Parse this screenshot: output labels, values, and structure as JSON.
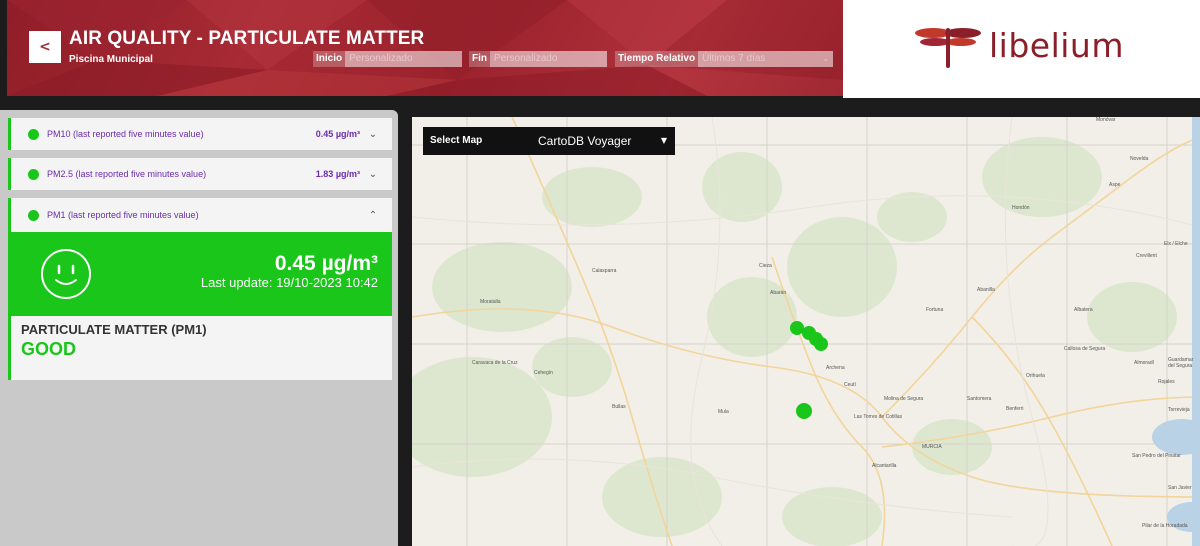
{
  "header": {
    "title": "AIR QUALITY - PARTICULATE MATTER",
    "subtitle": "Piscina Municipal",
    "back_icon": "chevron-left-icon",
    "filters": {
      "start_label": "Inicio",
      "start_value": "Personalizado",
      "end_label": "Fin",
      "end_value": "Personalizado",
      "relative_label": "Tiempo Relativo",
      "relative_value": "Últimos 7 días"
    },
    "logo_text": "libelium",
    "brand_color": "#8a1f2a",
    "banner_color": "#a72a34"
  },
  "sensors": [
    {
      "label": "PM10 (last reported five minutes value)",
      "value": "0.45 µg/m³",
      "expanded": false
    },
    {
      "label": "PM2.5 (last reported five minutes value)",
      "value": "1.83 µg/m³",
      "expanded": false
    },
    {
      "label": "PM1 (last reported five minutes value)",
      "value": "",
      "expanded": true
    }
  ],
  "detail": {
    "big_value": "0.45 µg/m³",
    "last_update": "Last update: 19/10-2023 10:42",
    "title": "PARTICULATE MATTER (PM1)",
    "status": "GOOD",
    "status_color": "#19c619",
    "face_icon": "smiley-icon"
  },
  "map": {
    "select_label": "Select Map",
    "select_value": "CartoDB Voyager",
    "places": [
      "Cieza",
      "Abarán",
      "Calasparra",
      "Moratalla",
      "Caravaca de la Cruz",
      "Cehegín",
      "Bullas",
      "Mula",
      "Archena",
      "Ceutí",
      "Molina de Segura",
      "Las Torres de Cotillas",
      "MURCIA",
      "Alcantarilla",
      "Fortuna",
      "Abanilla",
      "Albatera",
      "Crevillent",
      "Elx / Elche",
      "Aspe",
      "Novelda",
      "Monóvar",
      "Callosa de Segura",
      "Almoradí",
      "Orihuela",
      "Benferri",
      "Santomera",
      "San Pedro del Pinatar",
      "San Javier",
      "Torrevieja",
      "Guardamar del Segura",
      "Rojales",
      "Hondón",
      "Pilar de la Horadada"
    ]
  }
}
